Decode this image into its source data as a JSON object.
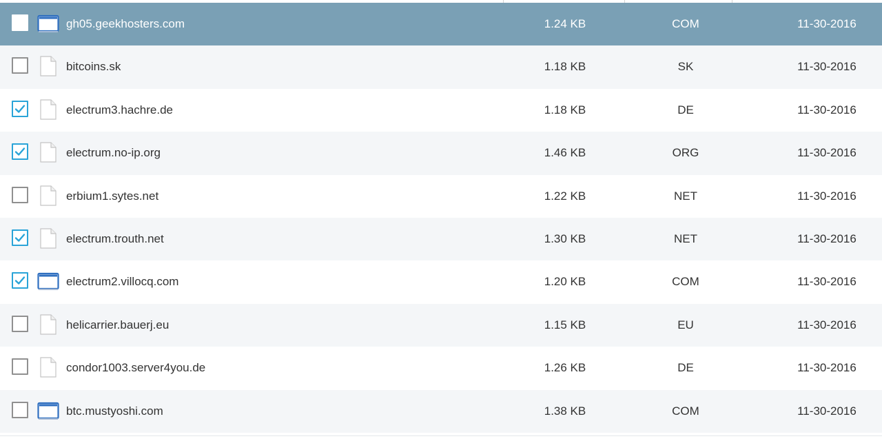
{
  "rows": [
    {
      "name": "gh05.geekhosters.com",
      "size": "1.24 KB",
      "ext": "COM",
      "date": "11-30-2016",
      "checked": false,
      "selected": true,
      "icon": "window-icon"
    },
    {
      "name": "bitcoins.sk",
      "size": "1.18 KB",
      "ext": "SK",
      "date": "11-30-2016",
      "checked": false,
      "selected": false,
      "icon": "document-icon"
    },
    {
      "name": "electrum3.hachre.de",
      "size": "1.18 KB",
      "ext": "DE",
      "date": "11-30-2016",
      "checked": true,
      "selected": false,
      "icon": "document-icon"
    },
    {
      "name": "electrum.no-ip.org",
      "size": "1.46 KB",
      "ext": "ORG",
      "date": "11-30-2016",
      "checked": true,
      "selected": false,
      "icon": "document-icon"
    },
    {
      "name": "erbium1.sytes.net",
      "size": "1.22 KB",
      "ext": "NET",
      "date": "11-30-2016",
      "checked": false,
      "selected": false,
      "icon": "document-icon"
    },
    {
      "name": "electrum.trouth.net",
      "size": "1.30 KB",
      "ext": "NET",
      "date": "11-30-2016",
      "checked": true,
      "selected": false,
      "icon": "document-icon"
    },
    {
      "name": "electrum2.villocq.com",
      "size": "1.20 KB",
      "ext": "COM",
      "date": "11-30-2016",
      "checked": true,
      "selected": false,
      "icon": "window-icon"
    },
    {
      "name": "helicarrier.bauerj.eu",
      "size": "1.15 KB",
      "ext": "EU",
      "date": "11-30-2016",
      "checked": false,
      "selected": false,
      "icon": "document-icon"
    },
    {
      "name": "condor1003.server4you.de",
      "size": "1.26 KB",
      "ext": "DE",
      "date": "11-30-2016",
      "checked": false,
      "selected": false,
      "icon": "document-icon"
    },
    {
      "name": "btc.mustyoshi.com",
      "size": "1.38 KB",
      "ext": "COM",
      "date": "11-30-2016",
      "checked": false,
      "selected": false,
      "icon": "window-icon"
    }
  ],
  "colors": {
    "selected_row": "#7aa0b5",
    "alt_row": "#f4f6f8",
    "checkbox_checked": "#2aa4d8",
    "window_icon": "#2f6fc0",
    "text": "#333333"
  }
}
